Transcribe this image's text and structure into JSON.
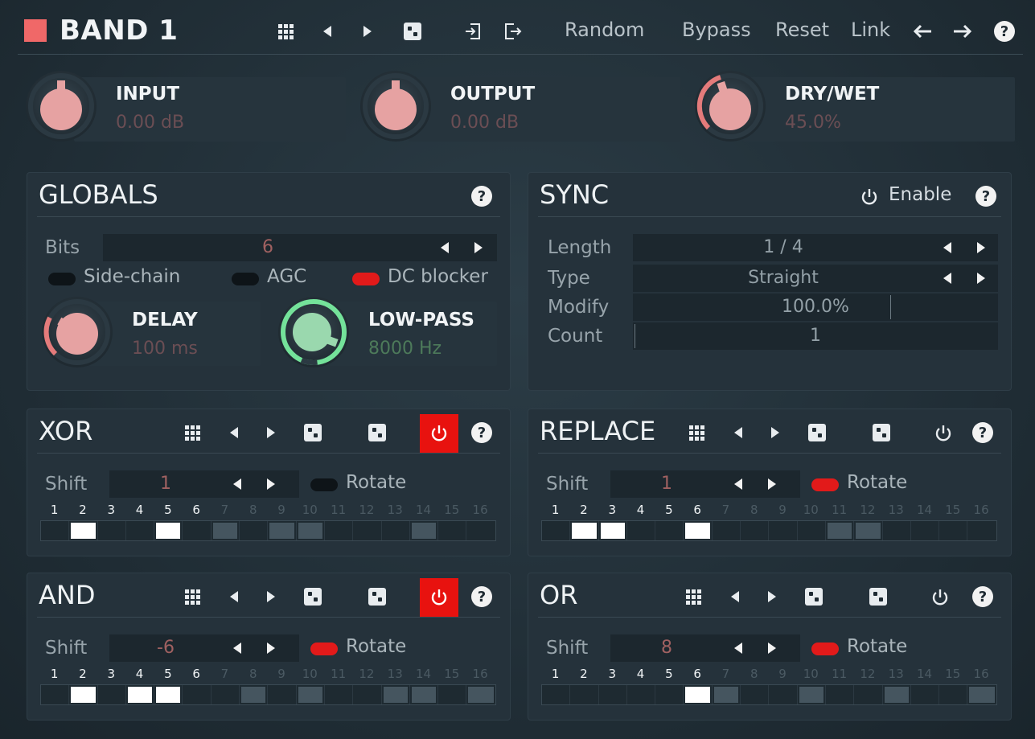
{
  "header": {
    "title": "BAND 1",
    "swatch_color": "#f06868",
    "icons": [
      "presets-grid-icon",
      "previous-icon",
      "next-icon",
      "randomize-icon",
      "import-icon",
      "export-icon"
    ],
    "random_label": "Random",
    "bypass_label": "Bypass",
    "reset_label": "Reset",
    "link_label": "Link",
    "undo_icon": "arrow-left-icon",
    "redo_icon": "arrow-right-icon",
    "help_label": "?"
  },
  "knobs": {
    "input": {
      "label": "INPUT",
      "value": "0.00 dB"
    },
    "output": {
      "label": "OUTPUT",
      "value": "0.00 dB"
    },
    "drywet": {
      "label": "DRY/WET",
      "value": "45.0%",
      "fraction": 0.45
    }
  },
  "globals": {
    "title": "GLOBALS",
    "help": "?",
    "bits_label": "Bits",
    "bits_value": "6",
    "sidechain_label": "Side-chain",
    "sidechain_on": false,
    "agc_label": "AGC",
    "agc_on": false,
    "dcblocker_label": "DC blocker",
    "dcblocker_on": true,
    "delay": {
      "label": "DELAY",
      "value": "100 ms"
    },
    "lowpass": {
      "label": "LOW-PASS",
      "value": "8000 Hz"
    }
  },
  "sync": {
    "title": "SYNC",
    "enable_label": "Enable",
    "help": "?",
    "length_label": "Length",
    "length_value": "1 / 4",
    "type_label": "Type",
    "type_value": "Straight",
    "modify_label": "Modify",
    "modify_value": "100.0%",
    "count_label": "Count",
    "count_value": "1"
  },
  "step_numbers": [
    "1",
    "2",
    "3",
    "4",
    "5",
    "6",
    "7",
    "8",
    "9",
    "10",
    "11",
    "12",
    "13",
    "14",
    "15",
    "16"
  ],
  "sections": {
    "xor": {
      "title": "XOR",
      "shift_label": "Shift",
      "shift_value": "1",
      "rotate_label": "Rotate",
      "rotate_on": false,
      "enabled": true,
      "help": "?",
      "steps": [
        "n",
        "w",
        "n",
        "n",
        "w",
        "n",
        "g",
        "n",
        "g",
        "g",
        "n",
        "n",
        "n",
        "g",
        "n",
        "n"
      ]
    },
    "replace": {
      "title": "REPLACE",
      "shift_label": "Shift",
      "shift_value": "1",
      "rotate_label": "Rotate",
      "rotate_on": true,
      "enabled": false,
      "help": "?",
      "steps": [
        "n",
        "w",
        "w",
        "n",
        "n",
        "w",
        "n",
        "n",
        "n",
        "n",
        "g",
        "g",
        "n",
        "n",
        "n",
        "n"
      ]
    },
    "and": {
      "title": "AND",
      "shift_label": "Shift",
      "shift_value": "-6",
      "rotate_label": "Rotate",
      "rotate_on": true,
      "enabled": true,
      "help": "?",
      "steps": [
        "n",
        "w",
        "n",
        "w",
        "w",
        "n",
        "n",
        "g",
        "n",
        "g",
        "n",
        "n",
        "g",
        "g",
        "n",
        "g"
      ]
    },
    "or": {
      "title": "OR",
      "shift_label": "Shift",
      "shift_value": "8",
      "rotate_label": "Rotate",
      "rotate_on": true,
      "enabled": false,
      "help": "?",
      "steps": [
        "n",
        "n",
        "n",
        "n",
        "n",
        "w",
        "g",
        "n",
        "n",
        "g",
        "n",
        "n",
        "g",
        "n",
        "n",
        "g"
      ]
    }
  }
}
